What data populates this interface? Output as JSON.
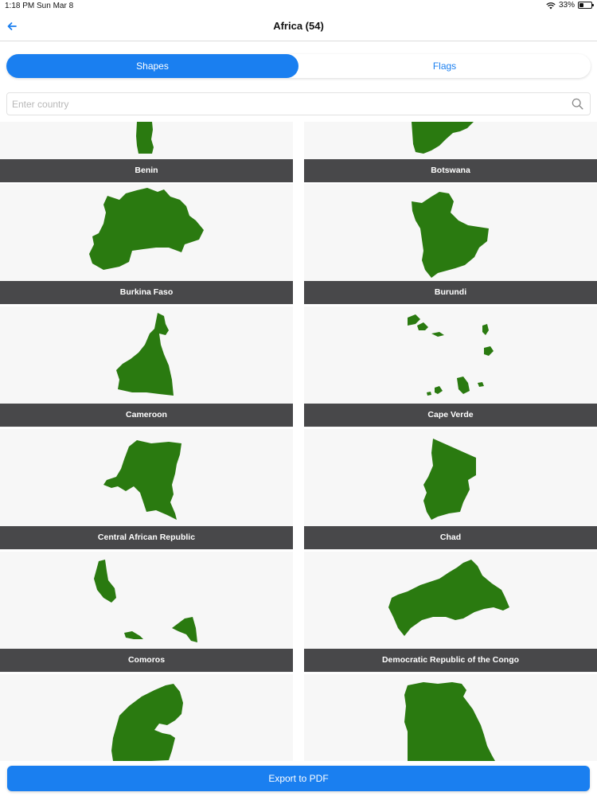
{
  "status_bar": {
    "time": "1:18 PM",
    "date": "Sun Mar 8",
    "battery": "33%",
    "battery_level": 0.33
  },
  "nav": {
    "back_icon": "arrow-left-icon",
    "title": "Africa (54)"
  },
  "segmented": {
    "shapes_label": "Shapes",
    "flags_label": "Flags",
    "selected": "Shapes"
  },
  "search": {
    "placeholder": "Enter country",
    "value": "",
    "icon": "search-icon"
  },
  "countries": [
    {
      "name": "Benin"
    },
    {
      "name": "Botswana"
    },
    {
      "name": "Burkina Faso"
    },
    {
      "name": "Burundi"
    },
    {
      "name": "Cameroon"
    },
    {
      "name": "Cape Verde"
    },
    {
      "name": "Central African Republic"
    },
    {
      "name": "Chad"
    },
    {
      "name": "Comoros"
    },
    {
      "name": "Democratic Republic of the Congo"
    },
    {
      "name": ""
    },
    {
      "name": ""
    }
  ],
  "export": {
    "label": "Export to PDF"
  },
  "colors": {
    "accent": "#1a7ff0",
    "shape_fill": "#2a7a10",
    "label_bg": "#48484a"
  }
}
